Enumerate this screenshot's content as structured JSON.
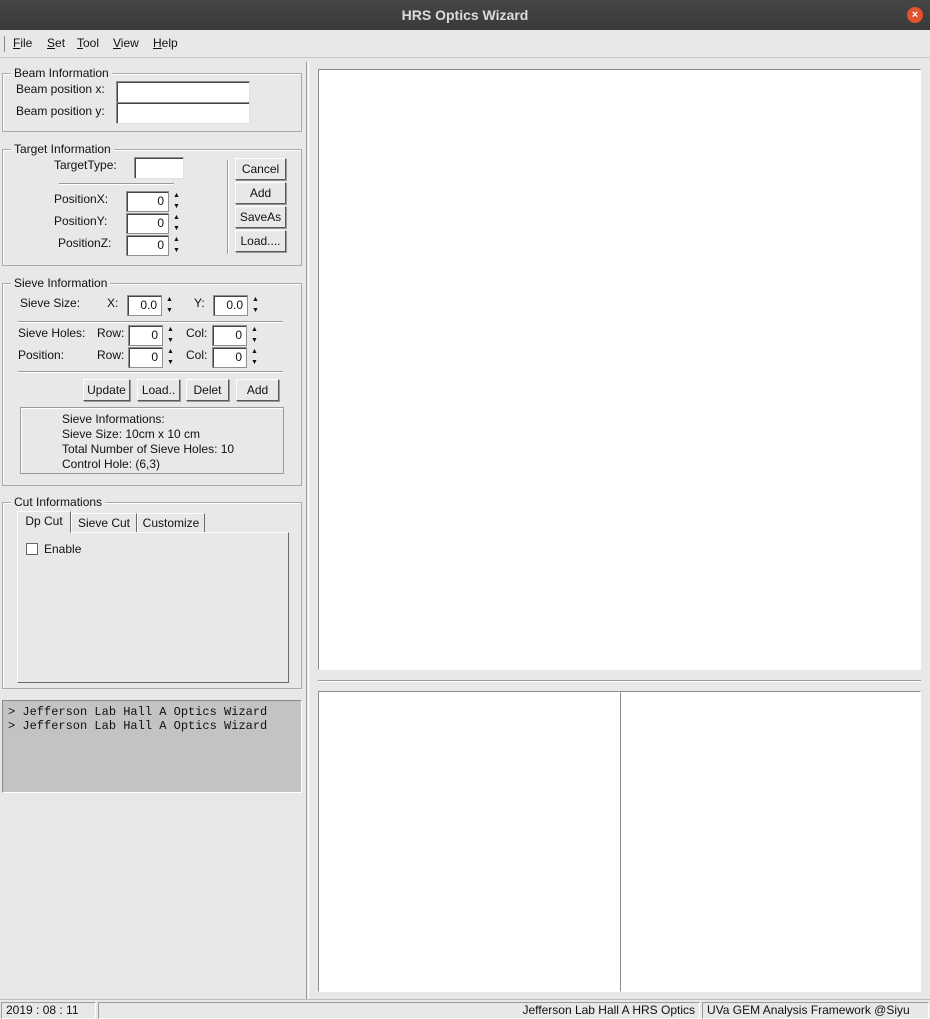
{
  "window": {
    "title": "HRS Optics Wizard",
    "close_glyph": "×"
  },
  "menu": [
    {
      "key": "F",
      "rest": "ile"
    },
    {
      "key": "S",
      "rest": "et"
    },
    {
      "key": "T",
      "rest": "ool"
    },
    {
      "key": "V",
      "rest": "iew"
    },
    {
      "key": "H",
      "rest": "elp"
    }
  ],
  "beam": {
    "legend": "Beam Information",
    "pos_x_label": "Beam position x:",
    "pos_y_label": "Beam position y:",
    "pos_x_value": "",
    "pos_y_value": ""
  },
  "target": {
    "legend": "Target Information",
    "type_label": "TargetType:",
    "type_value": "",
    "posx_label": "PositionX:",
    "posy_label": "PositionY:",
    "posz_label": "PositionZ:",
    "posx": "0",
    "posy": "0",
    "posz": "0",
    "buttons": {
      "cancel": "Cancel",
      "add": "Add",
      "saveas": "SaveAs",
      "load": "Load...."
    }
  },
  "sieve": {
    "legend": "Sieve Information",
    "size_label": "Sieve Size:",
    "x_label": "X:",
    "y_label": "Y:",
    "size_x": "0.0",
    "size_y": "0.0",
    "holes_label": "Sieve Holes:",
    "position_label": "Position:",
    "row_label": "Row:",
    "col_label": "Col:",
    "holes_row": "0",
    "holes_col": "0",
    "pos_row": "0",
    "pos_col": "0",
    "buttons": {
      "update": "Update",
      "load": "Load..",
      "delete": "Delet",
      "add": "Add"
    },
    "info_lines": [
      "Sieve Informations:",
      "Sieve Size: 10cm x 10 cm",
      "Total Number of Sieve Holes: 10",
      "Control Hole: (6,3)"
    ]
  },
  "cut": {
    "legend": "Cut Informations",
    "tabs": [
      "Dp Cut",
      "Sieve Cut",
      "Customize"
    ],
    "active_tab": "Dp Cut",
    "enable_label": "Enable",
    "enable_checked": false
  },
  "console": {
    "lines": [
      "> Jefferson Lab Hall A Optics Wizard",
      "> Jefferson Lab Hall A Optics Wizard"
    ]
  },
  "status": {
    "date": "2019 : 08 : 11",
    "center": "Jefferson Lab Hall A HRS Optics",
    "right": "UVa GEM Analysis Framework @Siyu"
  }
}
